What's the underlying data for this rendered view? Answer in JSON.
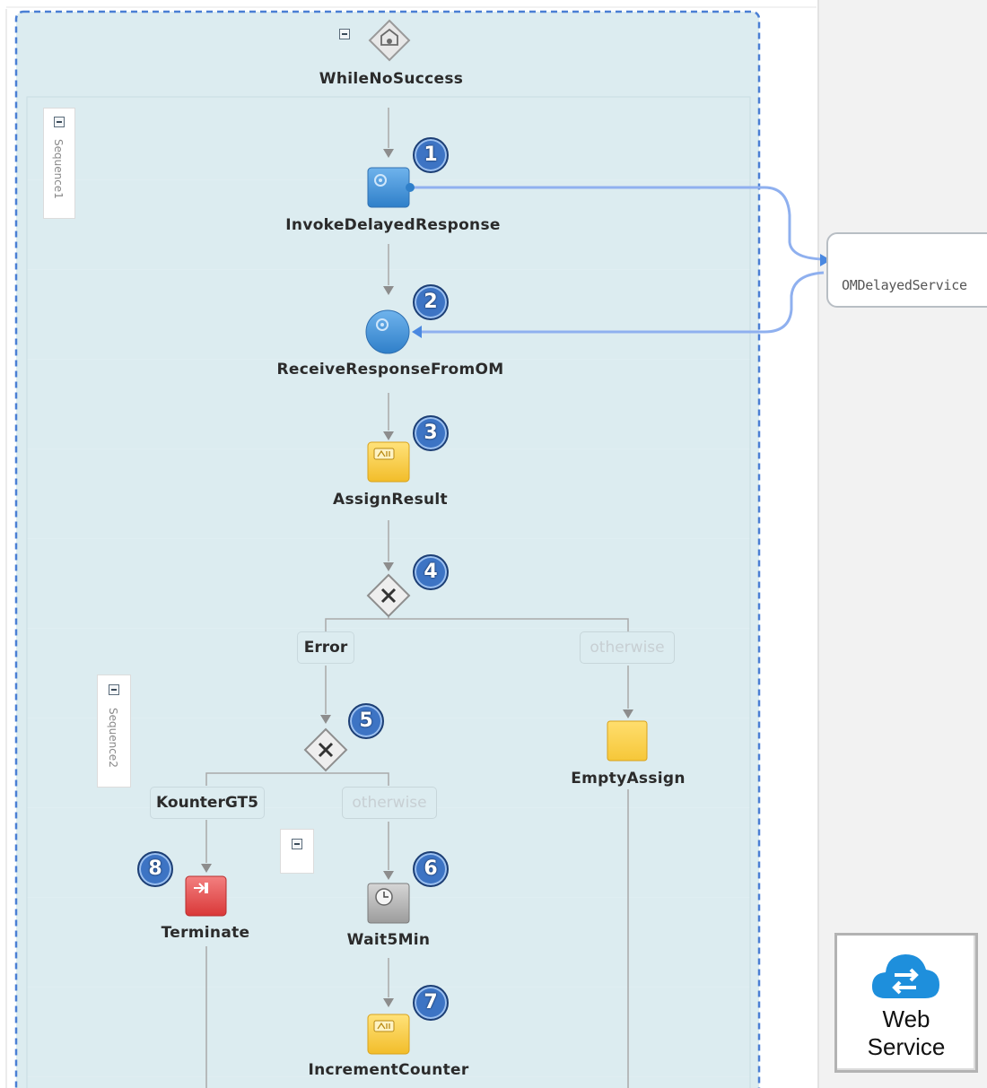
{
  "loop": {
    "label": "WhileNoSuccess"
  },
  "sequences": {
    "seq1": "Sequence1",
    "seq2": "Sequence2"
  },
  "activities": {
    "invoke": "InvokeDelayedResponse",
    "receive": "ReceiveResponseFromOM",
    "assign_result": "AssignResult",
    "empty_assign": "EmptyAssign",
    "terminate": "Terminate",
    "wait": "Wait5Min",
    "increment": "IncrementCounter"
  },
  "branches": {
    "error": "Error",
    "otherwise_1": "otherwise",
    "kounter": "KounterGT5",
    "otherwise_2": "otherwise"
  },
  "badges": [
    "1",
    "2",
    "3",
    "4",
    "5",
    "6",
    "7",
    "8"
  ],
  "partner_link": {
    "label": "OMDelayedService",
    "icon": "gear-icon"
  },
  "web_service": {
    "line1": "Web",
    "line2": "Service",
    "icon": "cloud-exchange-icon"
  },
  "colors": {
    "scope_bg": "#dcecf0",
    "scope_border": "#4a7fd4",
    "link_line": "#8fb0ef",
    "invoke_blue": "#3d8ed6",
    "assign_yellow": "#f6c739",
    "terminate_red": "#e04646",
    "wait_gray": "#a8a8a8",
    "badge_blue": "#3d74c4",
    "cloud_blue": "#1e8fdc"
  }
}
